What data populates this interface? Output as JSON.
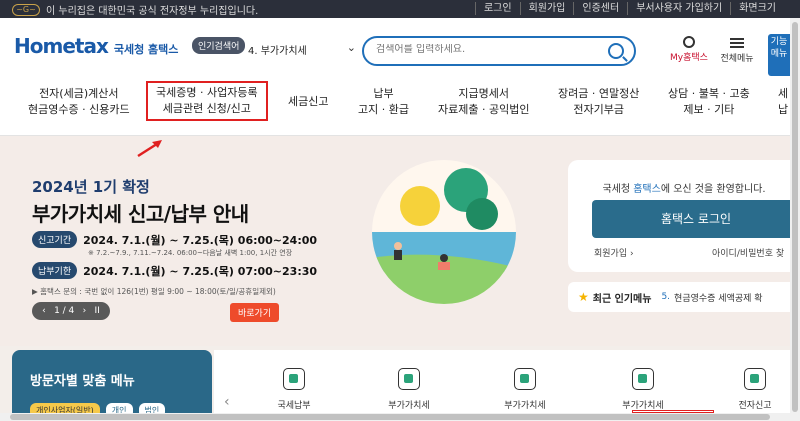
{
  "topbar": {
    "gov_notice": "이 누리집은 대한민국 공식 전자정부 누리집입니다.",
    "links": [
      "로그인",
      "회원가입",
      "인증센터",
      "부서사용자 가입하기",
      "화면크기"
    ]
  },
  "header": {
    "brand": "Hometax",
    "brand_sub": "국세청 홈택스",
    "popular_badge": "인기검색어",
    "popular_select": "4.  부가가치세",
    "search_placeholder": "검색어를 입력하세요.",
    "my_hometax": "My홈택스",
    "all_menu": "전체메뉴",
    "side_tab": "기능메뉴"
  },
  "nav": {
    "items": [
      {
        "l1": "전자(세금)계산서",
        "l2": "현금영수증 · 신용카드"
      },
      {
        "l1": "국세증명 · 사업자등록",
        "l2": "세금관련 신청/신고"
      },
      {
        "l1": "세금신고",
        "l2": ""
      },
      {
        "l1": "납부",
        "l2": "고지 · 환급"
      },
      {
        "l1": "지급명세서",
        "l2": "자료제출 · 공익법인"
      },
      {
        "l1": "장려금 · 연말정산",
        "l2": "전자기부금"
      },
      {
        "l1": "상담 · 불복 · 고충",
        "l2": "제보 · 기타"
      },
      {
        "l1": "세",
        "l2": "납"
      }
    ]
  },
  "hero": {
    "subtitle": "2024년 1기 확정",
    "title": "부가가치세 신고/납부 안내",
    "period1_tag": "신고기간",
    "period1_val": "2024. 7.1.(월) ~ 7.25.(목) 06:00~24:00",
    "note": "※ 7.2.~7.9., 7.11.~7.24. 06:00~다음날 새벽 1:00, 1시간 연장",
    "period2_tag": "납부기한",
    "period2_val": "2024. 7.1.(월) ~ 7.25.(목) 07:00~23:30",
    "inquiry": "▶ 홈택스 문의 : 국번 없이 126(1번) 평일 9:00 ~ 18:00(토/일/공휴일제외)",
    "pager": "1 / 4",
    "goto": "바로가기"
  },
  "login": {
    "welcome_pre": "국세청 ",
    "welcome_hl": "홈택스",
    "welcome_post": "에 오신 것을 환영합니다.",
    "button": "홈택스 로그인",
    "join": "회원가입",
    "find": "아이디/비밀번호 찾"
  },
  "popular": {
    "title": "최근 인기메뉴",
    "num": "5.",
    "text": "현금영수증 세액공제 확"
  },
  "visitor": {
    "title": "방문자별 맞춤 메뉴",
    "tabs": [
      "개인사업자(일반)",
      "개인",
      "법인"
    ]
  },
  "quick": {
    "items": [
      "국세납부",
      "부가가치세",
      "부가가치세",
      "부가가치세",
      "전자신고"
    ]
  }
}
